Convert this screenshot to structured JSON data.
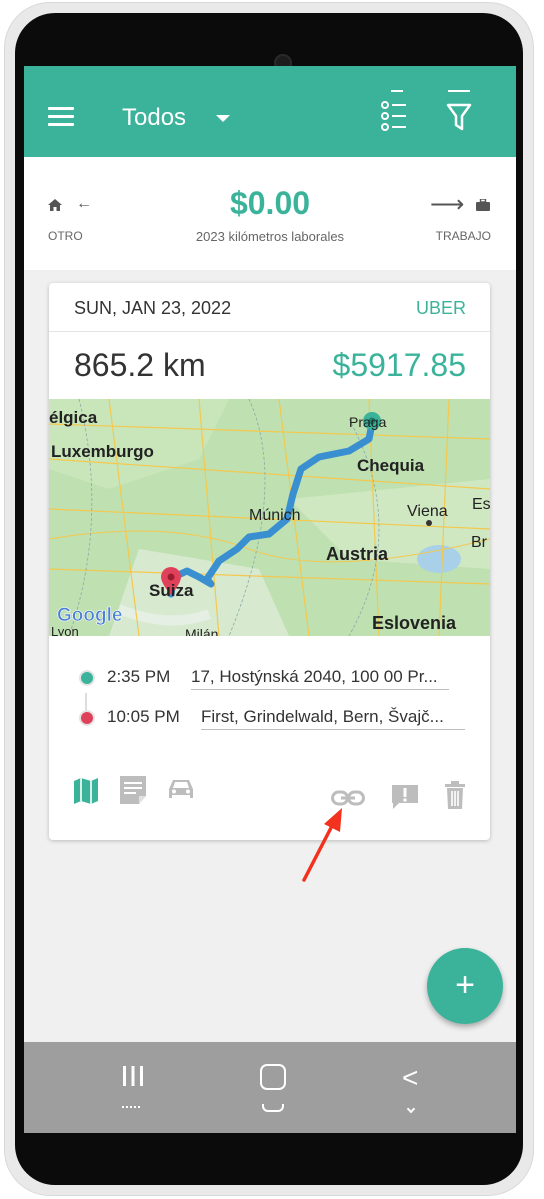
{
  "header": {
    "title": "Todos",
    "menu_icon": "hamburger-menu-icon",
    "view_icon": "list-view-icon",
    "filter_icon": "filter-icon"
  },
  "summary": {
    "amount": "$0.00",
    "subtitle": "2023 kilómetros laborales",
    "left_label": "OTRO",
    "right_label": "TRABAJO",
    "left_icons": [
      "home-icon",
      "arrow-left-icon"
    ],
    "right_icons": [
      "arrow-right-icon",
      "briefcase-icon"
    ]
  },
  "trip": {
    "date": "SUN, JAN 23, 2022",
    "type": "UBER",
    "distance": "865.2 km",
    "value": "$5917.85",
    "map": {
      "labels": [
        "élgica",
        "Luxemburgo",
        "Praga",
        "Chequia",
        "Es",
        "Múnich",
        "Viena",
        "Br",
        "Austria",
        "Suiza",
        "Google",
        "Eslovenia",
        "Lyon",
        "Milán"
      ]
    },
    "start": {
      "time": "2:35 PM",
      "address": "17, Hostýnská 2040, 100 00 Pr..."
    },
    "end": {
      "time": "10:05 PM",
      "address": "First, Grindelwald, Bern, Švajč..."
    },
    "actions": [
      "map-icon",
      "note-icon",
      "car-icon",
      "link-icon",
      "report-icon",
      "delete-icon"
    ]
  },
  "fab": {
    "label": "+"
  },
  "colors": {
    "accent": "#3bb39a",
    "start_dot": "#3bb39a",
    "end_pin": "#e0415a",
    "route": "#3a8fd0",
    "annotation": "#f2321e"
  }
}
